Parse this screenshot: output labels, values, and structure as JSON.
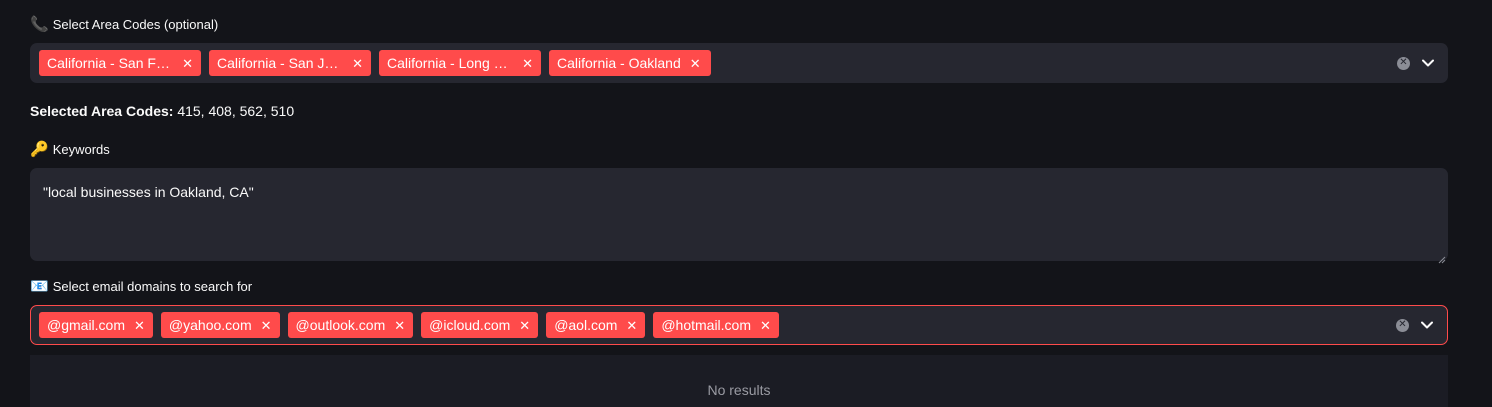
{
  "area_codes": {
    "label_icon": "📞",
    "label": "Select Area Codes (optional)",
    "tags": [
      {
        "text": "California - San Francisco"
      },
      {
        "text": "California - San Jose"
      },
      {
        "text": "California - Long Beach"
      },
      {
        "text": "California - Oakland"
      }
    ],
    "icons": {
      "clear": "clear-circle-icon",
      "dropdown": "chevron-down-icon"
    }
  },
  "summary": {
    "label": "Selected Area Codes:",
    "value": "415, 408, 562, 510"
  },
  "keywords": {
    "label_icon": "🔑",
    "label": "Keywords",
    "value": "\"local businesses in Oakland, CA\""
  },
  "email_domains": {
    "label_icon": "📧",
    "label": "Select email domains to search for",
    "tags": [
      {
        "text": "@gmail.com"
      },
      {
        "text": "@yahoo.com"
      },
      {
        "text": "@outlook.com"
      },
      {
        "text": "@icloud.com"
      },
      {
        "text": "@aol.com"
      },
      {
        "text": "@hotmail.com"
      }
    ],
    "icons": {
      "clear": "clear-circle-icon",
      "dropdown": "chevron-down-icon"
    }
  },
  "dropdown": {
    "empty_text": "No results"
  },
  "colors": {
    "accent": "#ff4b4b",
    "background": "#131419",
    "input_bg": "#262730"
  }
}
